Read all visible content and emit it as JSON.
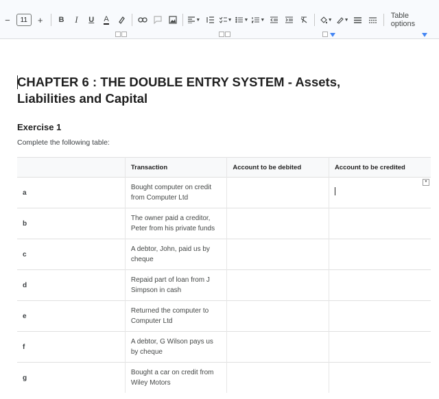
{
  "toolbar": {
    "font_size": "11",
    "bold": "B",
    "italic": "I",
    "underline": "U",
    "text_color": "A",
    "minus": "−",
    "plus": "+",
    "table_options": "Table options"
  },
  "doc": {
    "heading": "CHAPTER 6 : THE DOUBLE ENTRY SYSTEM - Assets, Liabilities and Capital",
    "subheading": "Exercise 1",
    "instruction": "Complete the following table:"
  },
  "table": {
    "headers": [
      "",
      "Transaction",
      "Account to be debited",
      "Account to be credited"
    ],
    "rows": [
      {
        "label": "a",
        "transaction": "Bought computer on credit from Computer Ltd"
      },
      {
        "label": "b",
        "transaction": "The owner paid a creditor, Peter from his private funds"
      },
      {
        "label": "c",
        "transaction": "A debtor, John, paid us by cheque"
      },
      {
        "label": "d",
        "transaction": "Repaid part of loan from J Simpson in cash"
      },
      {
        "label": "e",
        "transaction": "Returned the computer to Computer Ltd"
      },
      {
        "label": "f",
        "transaction": "A debtor, G Wilson pays us by cheque"
      },
      {
        "label": "g",
        "transaction": "Bought a car on credit from Wiley Motors"
      }
    ]
  }
}
